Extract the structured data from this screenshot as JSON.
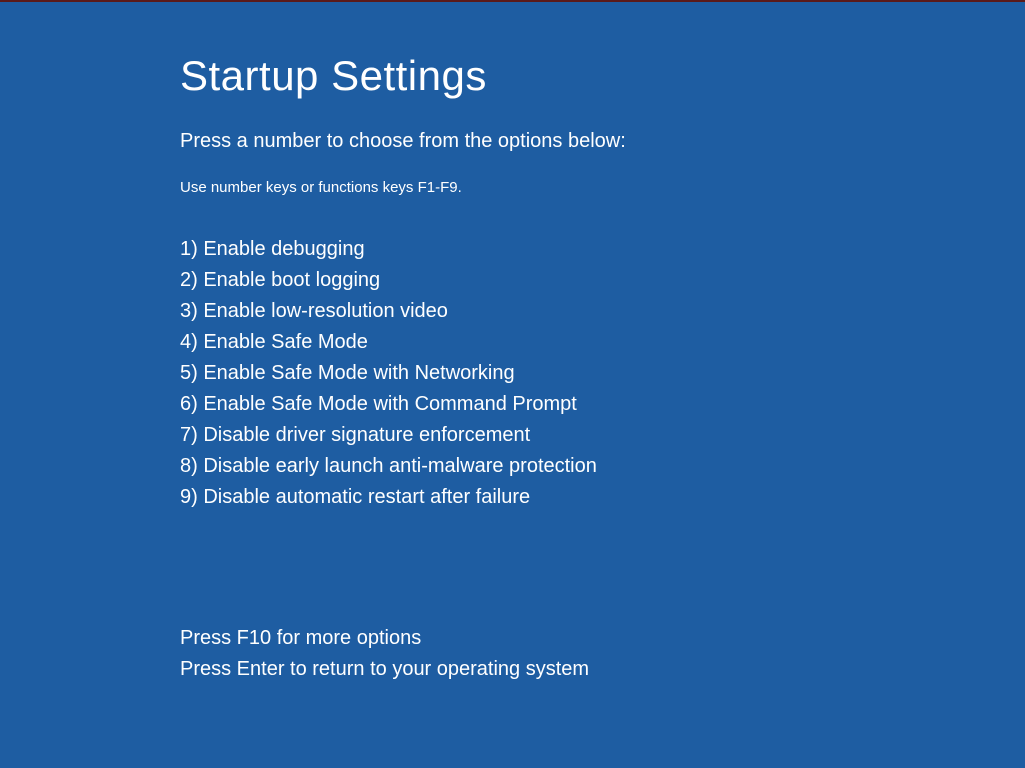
{
  "title": "Startup Settings",
  "subtitle": "Press a number to choose from the options below:",
  "hint": "Use number keys or functions keys F1-F9.",
  "options": [
    "1) Enable debugging",
    "2) Enable boot logging",
    "3) Enable low-resolution video",
    "4) Enable Safe Mode",
    "5) Enable Safe Mode with Networking",
    "6) Enable Safe Mode with Command Prompt",
    "7) Disable driver signature enforcement",
    "8) Disable early launch anti-malware protection",
    "9) Disable automatic restart after failure"
  ],
  "footer": [
    "Press F10 for more options",
    "Press Enter to return to your operating system"
  ]
}
